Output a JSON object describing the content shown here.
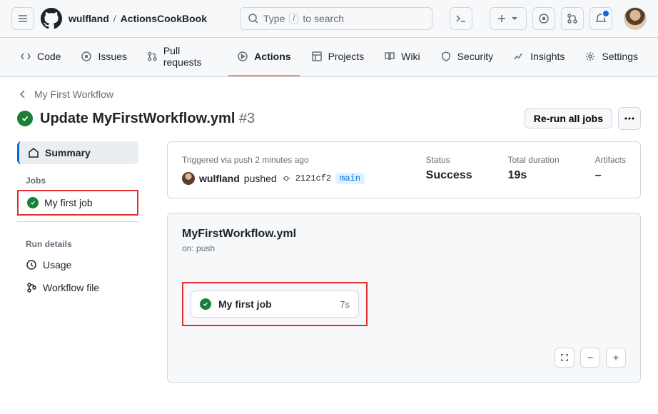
{
  "header": {
    "owner": "wulfland",
    "repo": "ActionsCookBook",
    "search_before": "Type",
    "search_slash": "/",
    "search_after": "to search"
  },
  "tabs": {
    "code": "Code",
    "issues": "Issues",
    "pulls": "Pull requests",
    "actions": "Actions",
    "projects": "Projects",
    "wiki": "Wiki",
    "security": "Security",
    "insights": "Insights",
    "settings": "Settings"
  },
  "run": {
    "back_label": "My First Workflow",
    "title": "Update MyFirstWorkflow.yml",
    "number": "#3",
    "rerun_label": "Re-run all jobs"
  },
  "sidebar": {
    "summary": "Summary",
    "jobs_header": "Jobs",
    "job1": "My first job",
    "run_details": "Run details",
    "usage": "Usage",
    "workflow_file": "Workflow file"
  },
  "summary": {
    "triggered_label": "Triggered via push 2 minutes ago",
    "actor": "wulfland",
    "action": "pushed",
    "sha": "2121cf2",
    "branch": "main",
    "status_label": "Status",
    "status_value": "Success",
    "duration_label": "Total duration",
    "duration_value": "19s",
    "artifacts_label": "Artifacts",
    "artifacts_value": "–"
  },
  "workflow": {
    "file": "MyFirstWorkflow.yml",
    "on": "on: push",
    "job_name": "My first job",
    "job_time": "7s"
  }
}
